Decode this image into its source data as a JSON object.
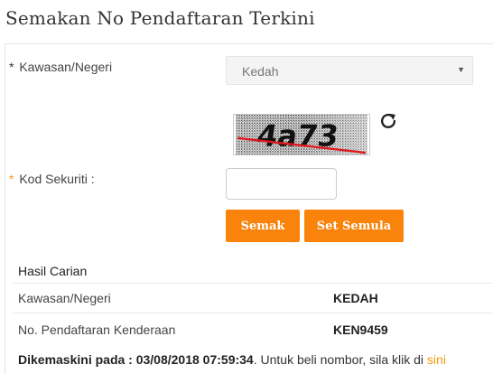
{
  "title": "Semakan No Pendaftaran Terkini",
  "form": {
    "region_label": "Kawasan/Negeri",
    "region_required_mark": "*",
    "region_selected": "Kedah",
    "captcha_text": "4a73",
    "security_label": "Kod Sekuriti :",
    "security_required_mark": "*",
    "security_value": "",
    "check_button": "Semak",
    "reset_button": "Set Semula"
  },
  "results": {
    "heading": "Hasil Carian",
    "rows": [
      {
        "label": "Kawasan/Negeri",
        "value": "KEDAH"
      },
      {
        "label": "No. Pendaftaran Kenderaan",
        "value": "KEN9459"
      }
    ]
  },
  "footer": {
    "updated_prefix": "Dikemaskini pada : 03/08/2018 07:59:34",
    "updated_suffix": ". Untuk beli nombor, sila klik di ",
    "link_text": "sini"
  },
  "colors": {
    "accent": "#f9830b",
    "link": "#f39c12",
    "captcha_line": "#e0191c"
  },
  "icons": {
    "refresh": "refresh-icon",
    "dropdown": "caret-down-icon"
  }
}
